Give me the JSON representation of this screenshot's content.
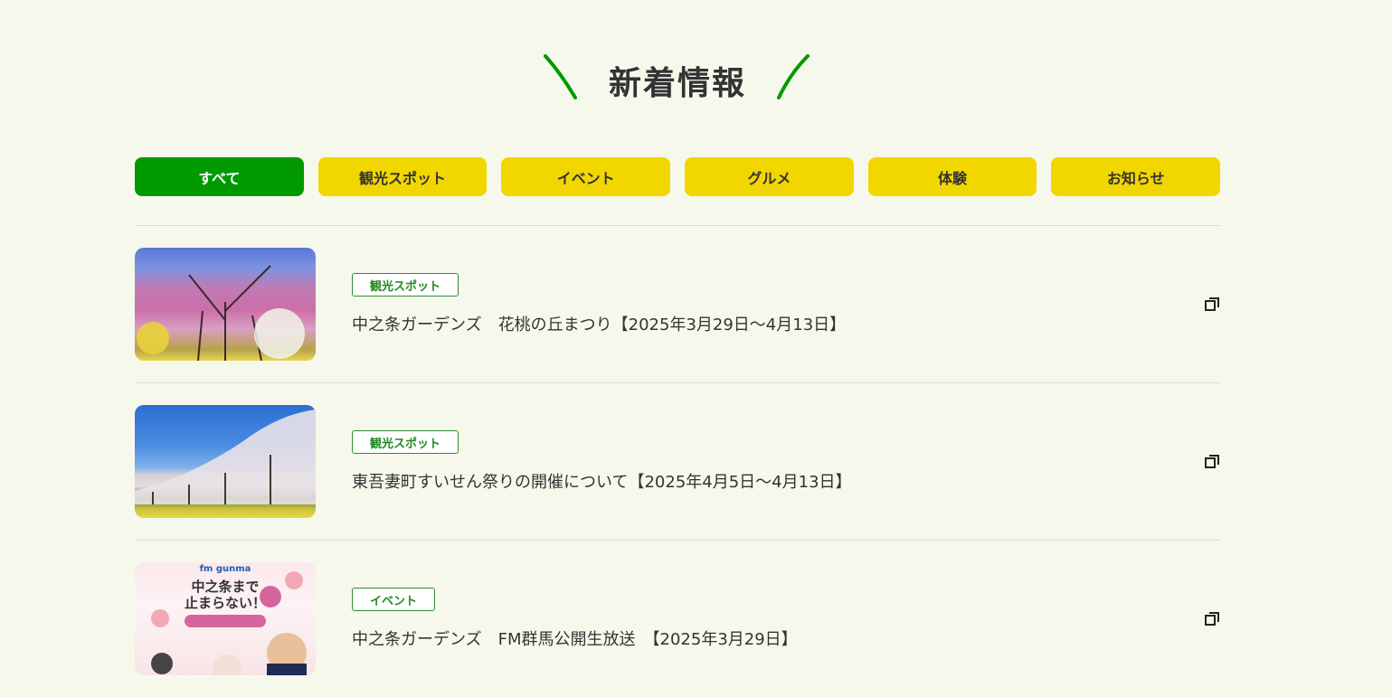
{
  "heading": "新着情報",
  "colors": {
    "accent_green": "#009a00",
    "tab_yellow": "#f2d600",
    "background": "#f7f8ec"
  },
  "tabs": [
    {
      "label": "すべて",
      "active": true
    },
    {
      "label": "観光スポット",
      "active": false
    },
    {
      "label": "イベント",
      "active": false
    },
    {
      "label": "グルメ",
      "active": false
    },
    {
      "label": "体験",
      "active": false
    },
    {
      "label": "お知らせ",
      "active": false
    }
  ],
  "news": [
    {
      "category": "観光スポット",
      "title": "中之条ガーデンズ　花桃の丘まつり【2025年3月29日〜4月13日】",
      "icon": "external-link-icon"
    },
    {
      "category": "観光スポット",
      "title": "東吾妻町すいせん祭りの開催について【2025年4月5日〜4月13日】",
      "icon": "external-link-icon"
    },
    {
      "category": "イベント",
      "title": "中之条ガーデンズ　FM群馬公開生放送　【2025年3月29日】",
      "icon": "external-link-icon"
    }
  ],
  "poster": {
    "line1": "中之条まで",
    "line2": "止まらない！",
    "brand": "fm gunma"
  }
}
